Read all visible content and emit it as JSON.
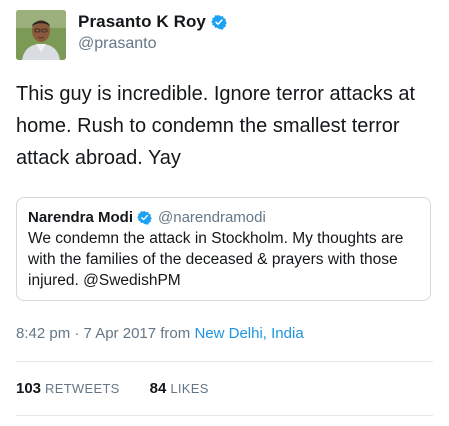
{
  "author": {
    "display_name": "Prasanto K Roy",
    "handle": "@prasanto",
    "verified_icon": "verified-badge-icon",
    "avatar": "profile-photo"
  },
  "tweet": {
    "text": "This guy is incredible. Ignore terror attacks at home. Rush to condemn the smallest terror attack abroad. Yay"
  },
  "quoted_tweet": {
    "display_name": "Narendra Modi",
    "handle": "@narendramodi",
    "verified_icon": "verified-badge-icon",
    "text": "We condemn the attack in Stockholm. My thoughts are with the families of the deceased & prayers with those injured. @SwedishPM"
  },
  "meta": {
    "timestamp": "8:42 pm · 7 Apr 2017 from ",
    "location": "New Delhi, India"
  },
  "stats": {
    "retweets_count": "103",
    "retweets_label": "RETWEETS",
    "likes_count": "84",
    "likes_label": "LIKES"
  },
  "colors": {
    "accent": "#1b95e0",
    "secondary_text": "#657786",
    "primary_text": "#14171a",
    "border": "#cfd9de"
  }
}
